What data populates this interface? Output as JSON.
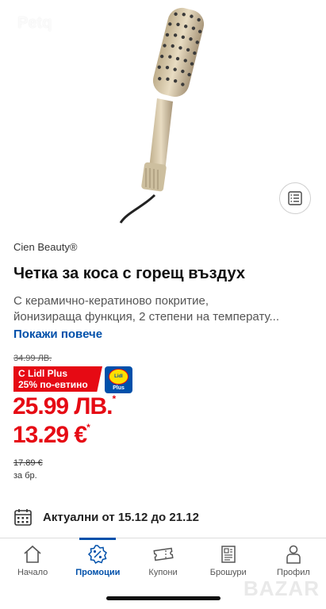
{
  "watermarks": {
    "top": "Petq",
    "bottom": "BAZAR"
  },
  "product": {
    "brand": "Cien Beauty®",
    "title": "Четка за коса с горещ въздух",
    "description_line1": "С керамично-кератиново покритие,",
    "description_line2": "йонизираща функция, 2 степени на температу...",
    "show_more": "Покажи повече"
  },
  "pricing": {
    "old_price_lv": "34.99 ЛВ.",
    "promo_line1": "С Lidl Plus",
    "promo_line2": "25% по-евтино",
    "plus_logo": "Lidl",
    "plus_label": "Plus",
    "price_lv": "25.99 ЛВ.",
    "price_lv_mark": "*",
    "price_eur": "13.29 €",
    "price_eur_mark": "*",
    "old_price_eur": "17.89 €",
    "unit": "за бр."
  },
  "validity": {
    "text": "Актуални от 15.12 до 21.12"
  },
  "nav": {
    "items": [
      {
        "label": "Начало",
        "icon": "home-icon"
      },
      {
        "label": "Промоции",
        "icon": "percent-badge-icon",
        "active": true
      },
      {
        "label": "Купони",
        "icon": "coupon-icon"
      },
      {
        "label": "Брошури",
        "icon": "brochure-icon"
      },
      {
        "label": "Профил",
        "icon": "profile-icon"
      }
    ]
  },
  "colors": {
    "accent": "#0050aa",
    "price": "#e60a14"
  }
}
